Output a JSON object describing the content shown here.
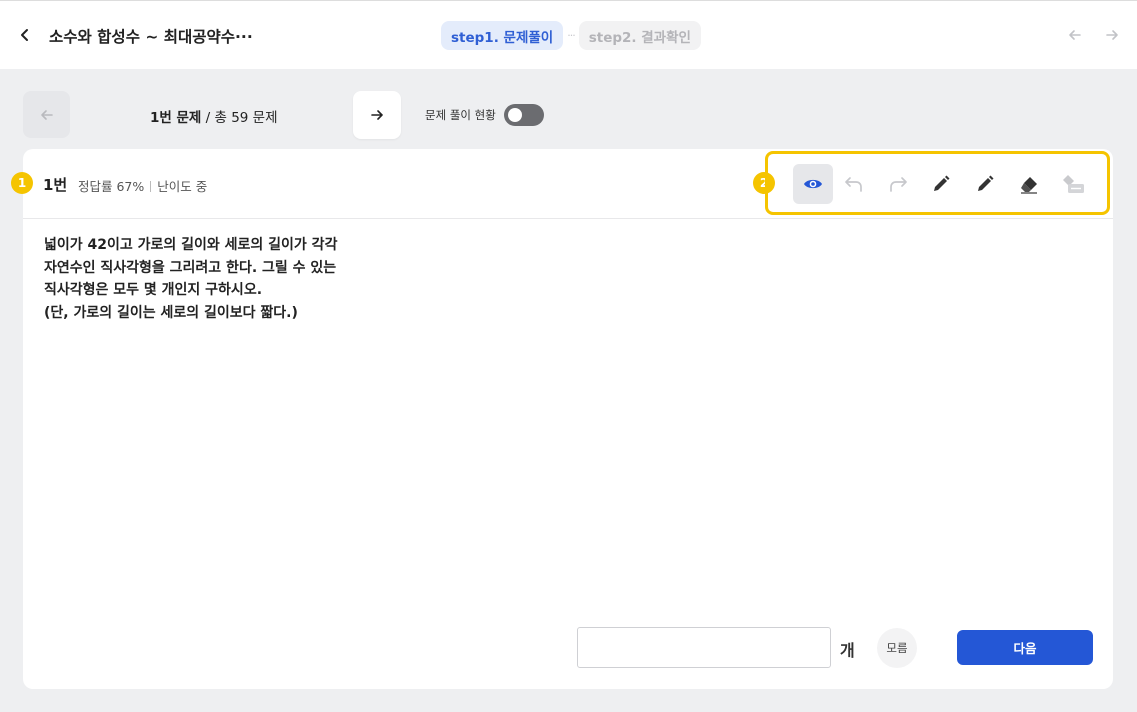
{
  "header": {
    "title": "소수와 합성수 ~ 최대공약수···",
    "steps": [
      {
        "label": "step1. 문제풀이"
      },
      {
        "label": "step2. 결과확인"
      }
    ],
    "step_separator": "···"
  },
  "navigation": {
    "current_question": "1번 문제",
    "total_separator": " / ",
    "total_questions": "총 59 문제",
    "status_label": "문제 풀이 현황",
    "status_toggle_on": false
  },
  "question_card": {
    "callout_1": "1",
    "callout_2": "2",
    "number": "1번",
    "accuracy": "정답률 67%",
    "difficulty": "난이도 중",
    "toolbar": [
      {
        "name": "view",
        "icon": "eye-icon",
        "selected": true
      },
      {
        "name": "undo",
        "icon": "undo-icon",
        "enabled": false
      },
      {
        "name": "redo",
        "icon": "redo-icon",
        "enabled": false
      },
      {
        "name": "pen",
        "icon": "pencil-icon"
      },
      {
        "name": "pen2",
        "icon": "pencil-icon"
      },
      {
        "name": "eraser",
        "icon": "eraser-icon"
      },
      {
        "name": "clear-all",
        "icon": "clear-all-eraser-icon",
        "enabled": false
      }
    ],
    "text_lines": [
      "넓이가 42이고 가로의 길이와 세로의 길이가 각각",
      "자연수인 직사각형을 그리려고 한다. 그릴 수 있는",
      "직사각형은 모두 몇 개인지 구하시오.",
      "(단, 가로의 길이는 세로의 길이보다 짧다.)"
    ]
  },
  "answer": {
    "value": "",
    "placeholder": "",
    "unit": "개",
    "unknown_label": "모름",
    "next_label": "다음"
  },
  "colors": {
    "accent_blue": "#2457d6",
    "callout_yellow": "#f5c400",
    "active_step_bg": "#e4ecfb"
  }
}
